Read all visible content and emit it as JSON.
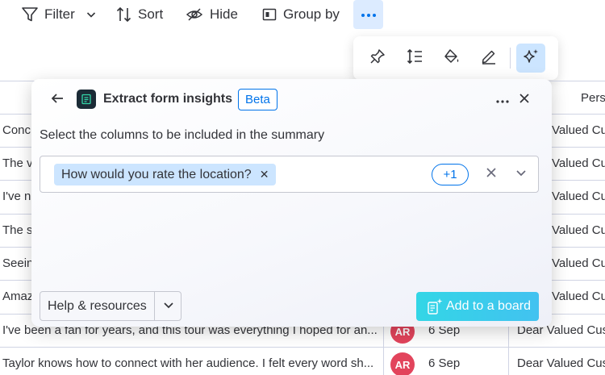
{
  "toolbar": {
    "filter_label": "Filter",
    "sort_label": "Sort",
    "hide_label": "Hide",
    "group_by_label": "Group by"
  },
  "icon_bar": {
    "icons": [
      "pin-icon",
      "row-height-icon",
      "paint-bucket-icon",
      "edit-pen-icon",
      "ai-sparkle-icon"
    ]
  },
  "table": {
    "header_person": "Pers",
    "rows": [
      {
        "text": "Conc",
        "person": "Valued Cus"
      },
      {
        "text": "The v",
        "person": "Valued Cus"
      },
      {
        "text": "I've n",
        "person": "Valued Cus"
      },
      {
        "text": "The s",
        "person": "Valued Cus"
      },
      {
        "text": "Seein",
        "person": "Valued Cus"
      },
      {
        "text": "Amaz",
        "person": "Valued Cus"
      },
      {
        "text": "I've been a fan for years, and this tour was everything I hoped for an...",
        "avatar": "AR",
        "date": "6 Sep",
        "person": "Dear Valued Cus"
      },
      {
        "text": "Taylor knows how to connect with her audience. I felt every word sh...",
        "avatar": "AR",
        "date": "6 Sep",
        "person": "Dear Valued Cus"
      }
    ]
  },
  "panel": {
    "title": "Extract form insights",
    "badge": "Beta",
    "instruction": "Select the columns to be included in the summary",
    "chip_label": "How would you rate the location?",
    "extra_count": "+1",
    "help_label": "Help & resources",
    "add_label": "Add to a board"
  },
  "colors": {
    "accent": "#0073ea",
    "chip_bg": "#cce5ff",
    "avatar": "#e2445c",
    "add_button": "#33d6e6"
  }
}
